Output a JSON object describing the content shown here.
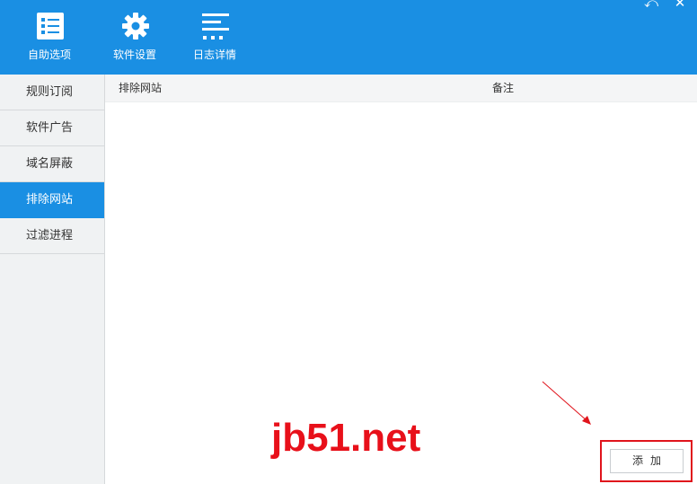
{
  "toolbar": {
    "items": [
      {
        "label": "自助选项",
        "icon": "checklist-icon"
      },
      {
        "label": "软件设置",
        "icon": "gear-icon"
      },
      {
        "label": "日志详情",
        "icon": "log-lines-icon"
      }
    ]
  },
  "window": {
    "restore_symbol": "⤺",
    "close_symbol": "✕"
  },
  "sidebar": {
    "items": [
      {
        "label": "规则订阅",
        "active": false
      },
      {
        "label": "软件广告",
        "active": false
      },
      {
        "label": "域名屏蔽",
        "active": false
      },
      {
        "label": "排除网站",
        "active": true
      },
      {
        "label": "过滤进程",
        "active": false
      }
    ]
  },
  "table": {
    "columns": [
      "排除网站",
      "备注"
    ],
    "rows": []
  },
  "actions": {
    "add_label": "添加"
  },
  "watermark": "jb51.net",
  "colors": {
    "accent": "#1a8fe3",
    "highlight": "#e0141c"
  }
}
